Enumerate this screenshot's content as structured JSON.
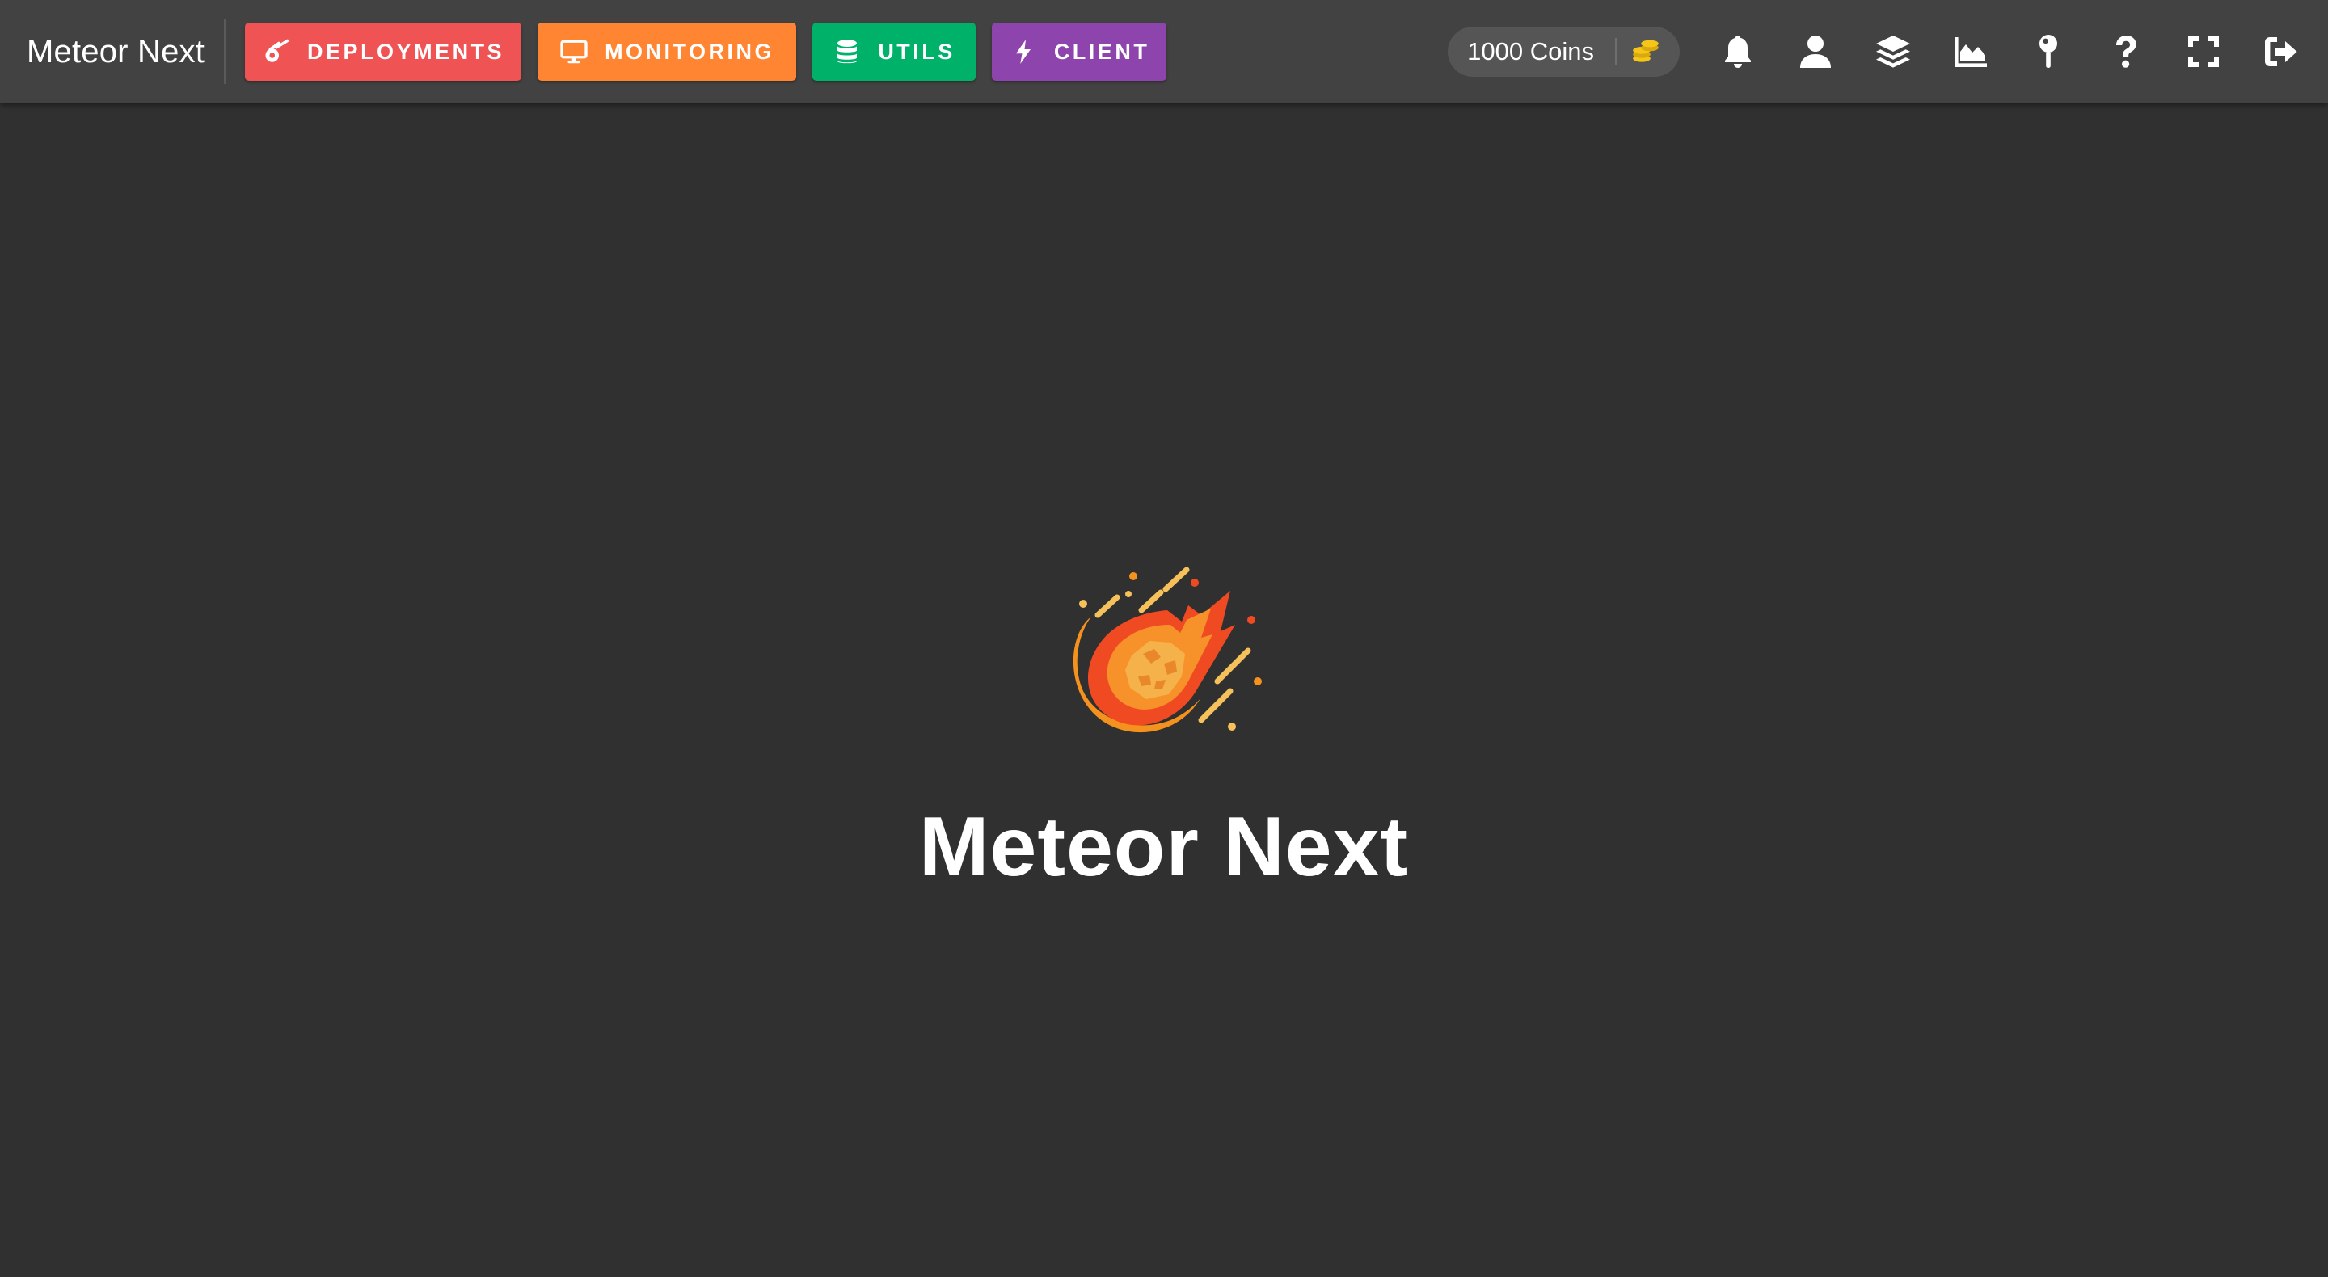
{
  "header": {
    "brand": "Meteor Next",
    "nav": [
      {
        "id": "deployments",
        "label": "DEPLOYMENTS",
        "icon": "meteor-icon",
        "color": "#EF5354"
      },
      {
        "id": "monitoring",
        "label": "MONITORING",
        "icon": "desktop-icon",
        "color": "#FF8533"
      },
      {
        "id": "utils",
        "label": "UTILS",
        "icon": "database-icon",
        "color": "#00B16A"
      },
      {
        "id": "client",
        "label": "CLIENT",
        "icon": "bolt-icon",
        "color": "#8E44AD"
      }
    ],
    "coins": {
      "label": "1000 Coins",
      "icon": "coins-icon",
      "color": "#F5C518"
    },
    "actions": [
      "bell-icon",
      "user-icon",
      "layers-icon",
      "area-chart-icon",
      "pin-icon",
      "question-icon",
      "fullscreen-icon",
      "logout-icon"
    ]
  },
  "hero": {
    "logo": "meteor-logo",
    "title": "Meteor Next"
  },
  "colors": {
    "background": "#303030",
    "toolbar": "#424242"
  }
}
